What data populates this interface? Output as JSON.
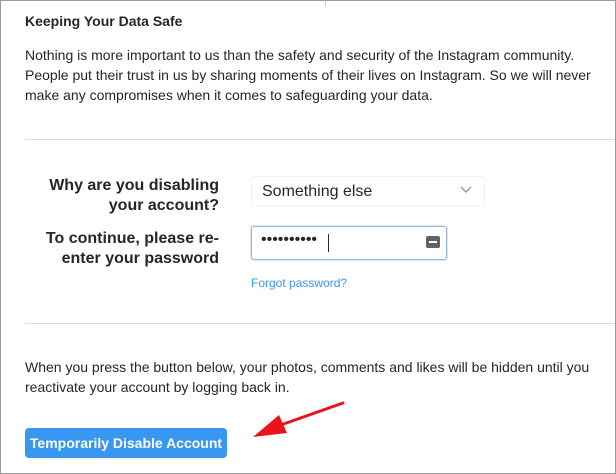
{
  "section": {
    "title": "Keeping Your Data Safe",
    "intro": "Nothing is more important to us than the safety and security of the Instagram community. People put their trust in us by sharing moments of their lives on Instagram. So we will never make any compromises when it comes to safeguarding your data."
  },
  "form": {
    "reason_label": "Why are you disabling your account?",
    "reason_selected": "Something else",
    "password_label": "To continue, please re-enter your password",
    "password_masked": "••••••••••",
    "forgot_password": "Forgot password?"
  },
  "notice": {
    "text": "When you press the button below, your photos, comments and likes will be hidden until you reactivate your account by logging back in."
  },
  "actions": {
    "disable_button": "Temporarily Disable Account"
  },
  "colors": {
    "accent": "#3897f0",
    "annotation_arrow": "#e8141a"
  },
  "icons": {
    "select_chevron": "chevron-down-icon",
    "password_manager": "keyboard-icon",
    "annotation": "red-arrow-icon"
  }
}
